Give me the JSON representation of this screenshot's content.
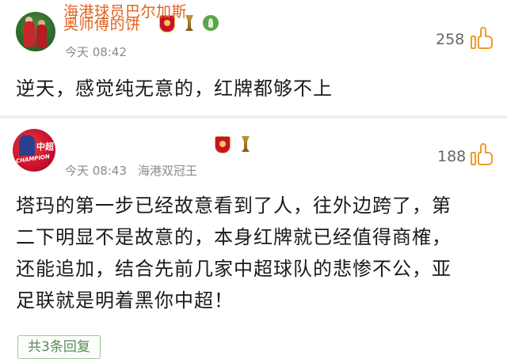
{
  "comments": [
    {
      "username": "奥师傅的饼",
      "time": "今天 08:42",
      "source": "",
      "like_count": "258",
      "badges": [
        "team-crest-icon",
        "trophy-icon",
        "plant-icon"
      ],
      "text_lines": [
        "逆天，感觉纯无意的，红牌都够不上"
      ]
    },
    {
      "username": "海港球员巴尔加斯",
      "time": "今天 08:43",
      "source": "海港双冠王",
      "like_count": "188",
      "badges": [
        "team-crest-icon",
        "trophy-icon"
      ],
      "avatar_text": "中超",
      "avatar_caption": "CHAMPION",
      "text_lines": [
        "塔玛的第一步已经故意看到了人，往外边跨了，第",
        "二下明显不是故意的，本身红牌就已经值得商榷，",
        "还能追加，结合先前几家中超球队的悲惨不公，亚",
        "足联就是明着黑你中超！"
      ],
      "replies_label": "共3条回复"
    }
  ],
  "colors": {
    "username": "#e0611d",
    "like_icon": "#f29a2e",
    "meta": "#8a8a8a"
  }
}
